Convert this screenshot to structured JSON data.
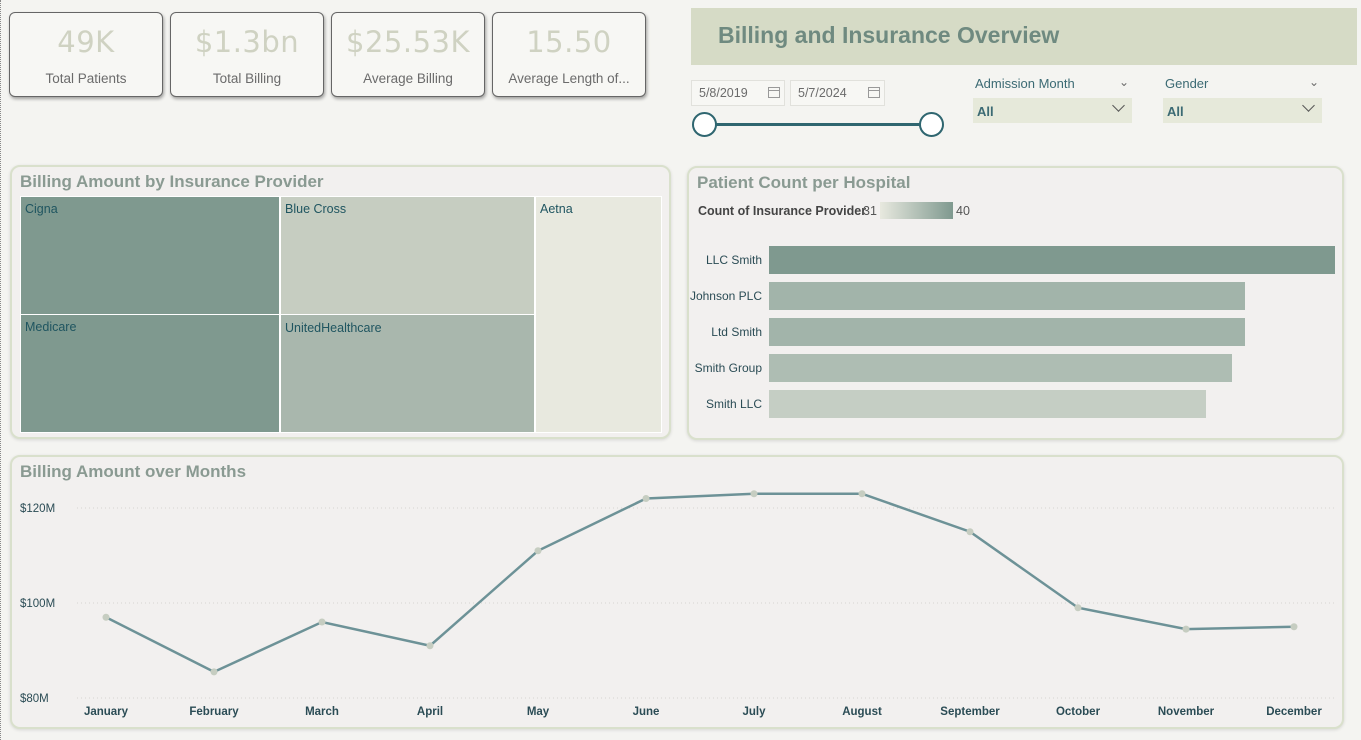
{
  "kpis": [
    {
      "value": "49K",
      "label": "Total Patients"
    },
    {
      "value": "$1.3bn",
      "label": "Total Billing"
    },
    {
      "value": "$25.53K",
      "label": "Average Billing"
    },
    {
      "value": "15.50",
      "label": "Average Length of..."
    }
  ],
  "header": {
    "title": "Billing and Insurance Overview"
  },
  "date_filter": {
    "start": "5/8/2019",
    "end": "5/7/2024"
  },
  "slicers": [
    {
      "label": "Admission Month",
      "value": "All"
    },
    {
      "label": "Gender",
      "value": "All"
    }
  ],
  "treemap": {
    "title": "Billing Amount by Insurance Provider",
    "providers": [
      "Cigna",
      "Blue Cross",
      "Aetna",
      "Medicare",
      "UnitedHealthcare"
    ],
    "colors": {
      "Cigna": "#7f998f",
      "Medicare": "#7f998f",
      "Blue Cross": "#c6cdc1",
      "UnitedHealthcare": "#a9b7ad",
      "Aetna": "#e8e9df"
    }
  },
  "hospital_chart": {
    "title": "Patient Count per Hospital",
    "legend_title": "Count of Insurance Provider",
    "legend_min": "31",
    "legend_max": "40",
    "legend_colors": [
      "#e8e9df",
      "#7f998f"
    ]
  },
  "line_chart": {
    "title": "Billing Amount over Months",
    "line_color": "#6d9297",
    "marker_color": "#c6cdc1"
  },
  "chart_data": [
    {
      "type": "treemap",
      "title": "Billing Amount by Insurance Provider",
      "categories": [
        "Cigna",
        "Medicare",
        "Blue Cross",
        "UnitedHealthcare",
        "Aetna"
      ],
      "values": [
        269,
        267,
        265,
        262,
        235
      ]
    },
    {
      "type": "bar",
      "orientation": "horizontal",
      "title": "Patient Count per Hospital",
      "categories": [
        "LLC Smith",
        "Johnson PLC",
        "Ltd Smith",
        "Smith Group",
        "Smith LLC"
      ],
      "values": [
        44,
        37,
        37,
        36,
        34
      ],
      "color_scale": {
        "label": "Count of Insurance Provider",
        "min": 31,
        "max": 40
      },
      "xlim": [
        0,
        44
      ]
    },
    {
      "type": "line",
      "title": "Billing Amount over Months",
      "x": [
        "January",
        "February",
        "March",
        "April",
        "May",
        "June",
        "July",
        "August",
        "September",
        "October",
        "November",
        "December"
      ],
      "y": [
        97000000,
        85500000,
        96000000,
        91000000,
        111000000,
        122000000,
        123000000,
        123000000,
        115000000,
        99000000,
        94500000,
        95000000
      ],
      "yticks": [
        80000000,
        100000000,
        120000000
      ],
      "ytick_labels": [
        "$80M",
        "$100M",
        "$120M"
      ],
      "ylim": [
        80000000,
        128000000
      ],
      "grid": true
    }
  ]
}
